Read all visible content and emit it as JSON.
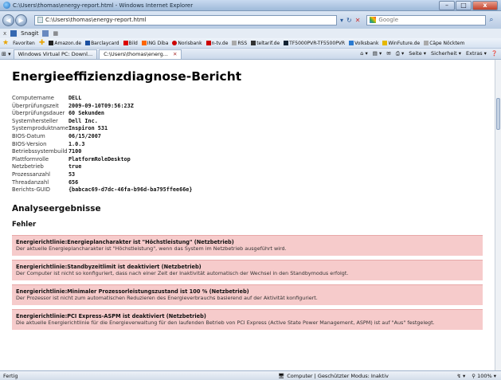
{
  "window": {
    "title": "C:\\Users\\thomas\\energy-report.html - Windows Internet Explorer",
    "minimize": "–",
    "maximize": "□",
    "close": "x"
  },
  "address": {
    "url": "C:\\Users\\thomas\\energy-report.html",
    "search_placeholder": "Google"
  },
  "snagit": {
    "close": "x",
    "label": "Snagit"
  },
  "favorites": {
    "label": "Favoriten",
    "items": [
      "Amazon.de",
      "Barclaycard",
      "Bild",
      "ING Diba",
      "Norisbank",
      "n-tv.de",
      "RSS",
      "teltarif.de",
      "TF5000PVR-TF5500PVR",
      "Volksbank",
      "WinFuture.de",
      "Cäpe Nöcktem"
    ]
  },
  "tabs": [
    {
      "label": "Windows Virtual PC: Downl..."
    },
    {
      "label": "C:\\Users\\thomas\\energ..."
    }
  ],
  "commandbar": {
    "page": "Seite ▾",
    "safety": "Sicherheit ▾",
    "extras": "Extras ▾"
  },
  "report": {
    "title": "Energieeffizienzdiagnose-Bericht",
    "info": [
      {
        "k": "Computername",
        "v": "DELL"
      },
      {
        "k": "Überprüfungszeit",
        "v": "2009-09-10T09:56:23Z"
      },
      {
        "k": "Überprüfungsdauer",
        "v": "60 Sekunden"
      },
      {
        "k": "Systemhersteller",
        "v": "Dell Inc."
      },
      {
        "k": "Systemproduktname",
        "v": "Inspiron 531"
      },
      {
        "k": "BIOS-Datum",
        "v": "06/15/2007"
      },
      {
        "k": "BIOS-Version",
        "v": "1.0.3"
      },
      {
        "k": "Betriebssystembuild",
        "v": "7100"
      },
      {
        "k": "Plattformrolle",
        "v": "PlatformRoleDesktop"
      },
      {
        "k": "Netzbetrieb",
        "v": "true"
      },
      {
        "k": "Prozessanzahl",
        "v": "53"
      },
      {
        "k": "Threadanzahl",
        "v": "656"
      },
      {
        "k": "Berichts-GUID",
        "v": "{babcac69-d7dc-46fa-b96d-ba795ffee66e}"
      }
    ],
    "analysis_heading": "Analyseergebnisse",
    "errors_heading": "Fehler",
    "findings": [
      {
        "title": "Energierichtlinie:Energieplancharakter ist \"Höchstleistung\" (Netzbetrieb)",
        "desc": "Der aktuelle Energieplancharakter ist \"Höchstleistung\", wenn das System im Netzbetrieb ausgeführt wird."
      },
      {
        "title": "Energierichtlinie:Standbyzeitlimit ist deaktiviert (Netzbetrieb)",
        "desc": "Der Computer ist nicht so konfiguriert, dass nach einer Zeit der Inaktivität automatisch der Wechsel in den Standbymodus erfolgt."
      },
      {
        "title": "Energierichtlinie:Minimaler Prozessorleistungszustand ist 100 % (Netzbetrieb)",
        "desc": "Der Prozessor ist nicht zum automatischen Reduzieren des Energieverbrauchs basierend auf der Aktivität konfiguriert."
      },
      {
        "title": "Energierichtlinie:PCI Express-ASPM ist deaktiviert (Netzbetrieb)",
        "desc": "Die aktuelle Energierichtlinie für die Energieverwaltung für den laufenden Betrieb von PCI Express (Active State Power Management, ASPM) ist auf \"Aus\" festgelegt."
      }
    ]
  },
  "status": {
    "left": "Fertig",
    "zone": "Computer | Geschützter Modus: Inaktiv",
    "zoom": "100%"
  }
}
